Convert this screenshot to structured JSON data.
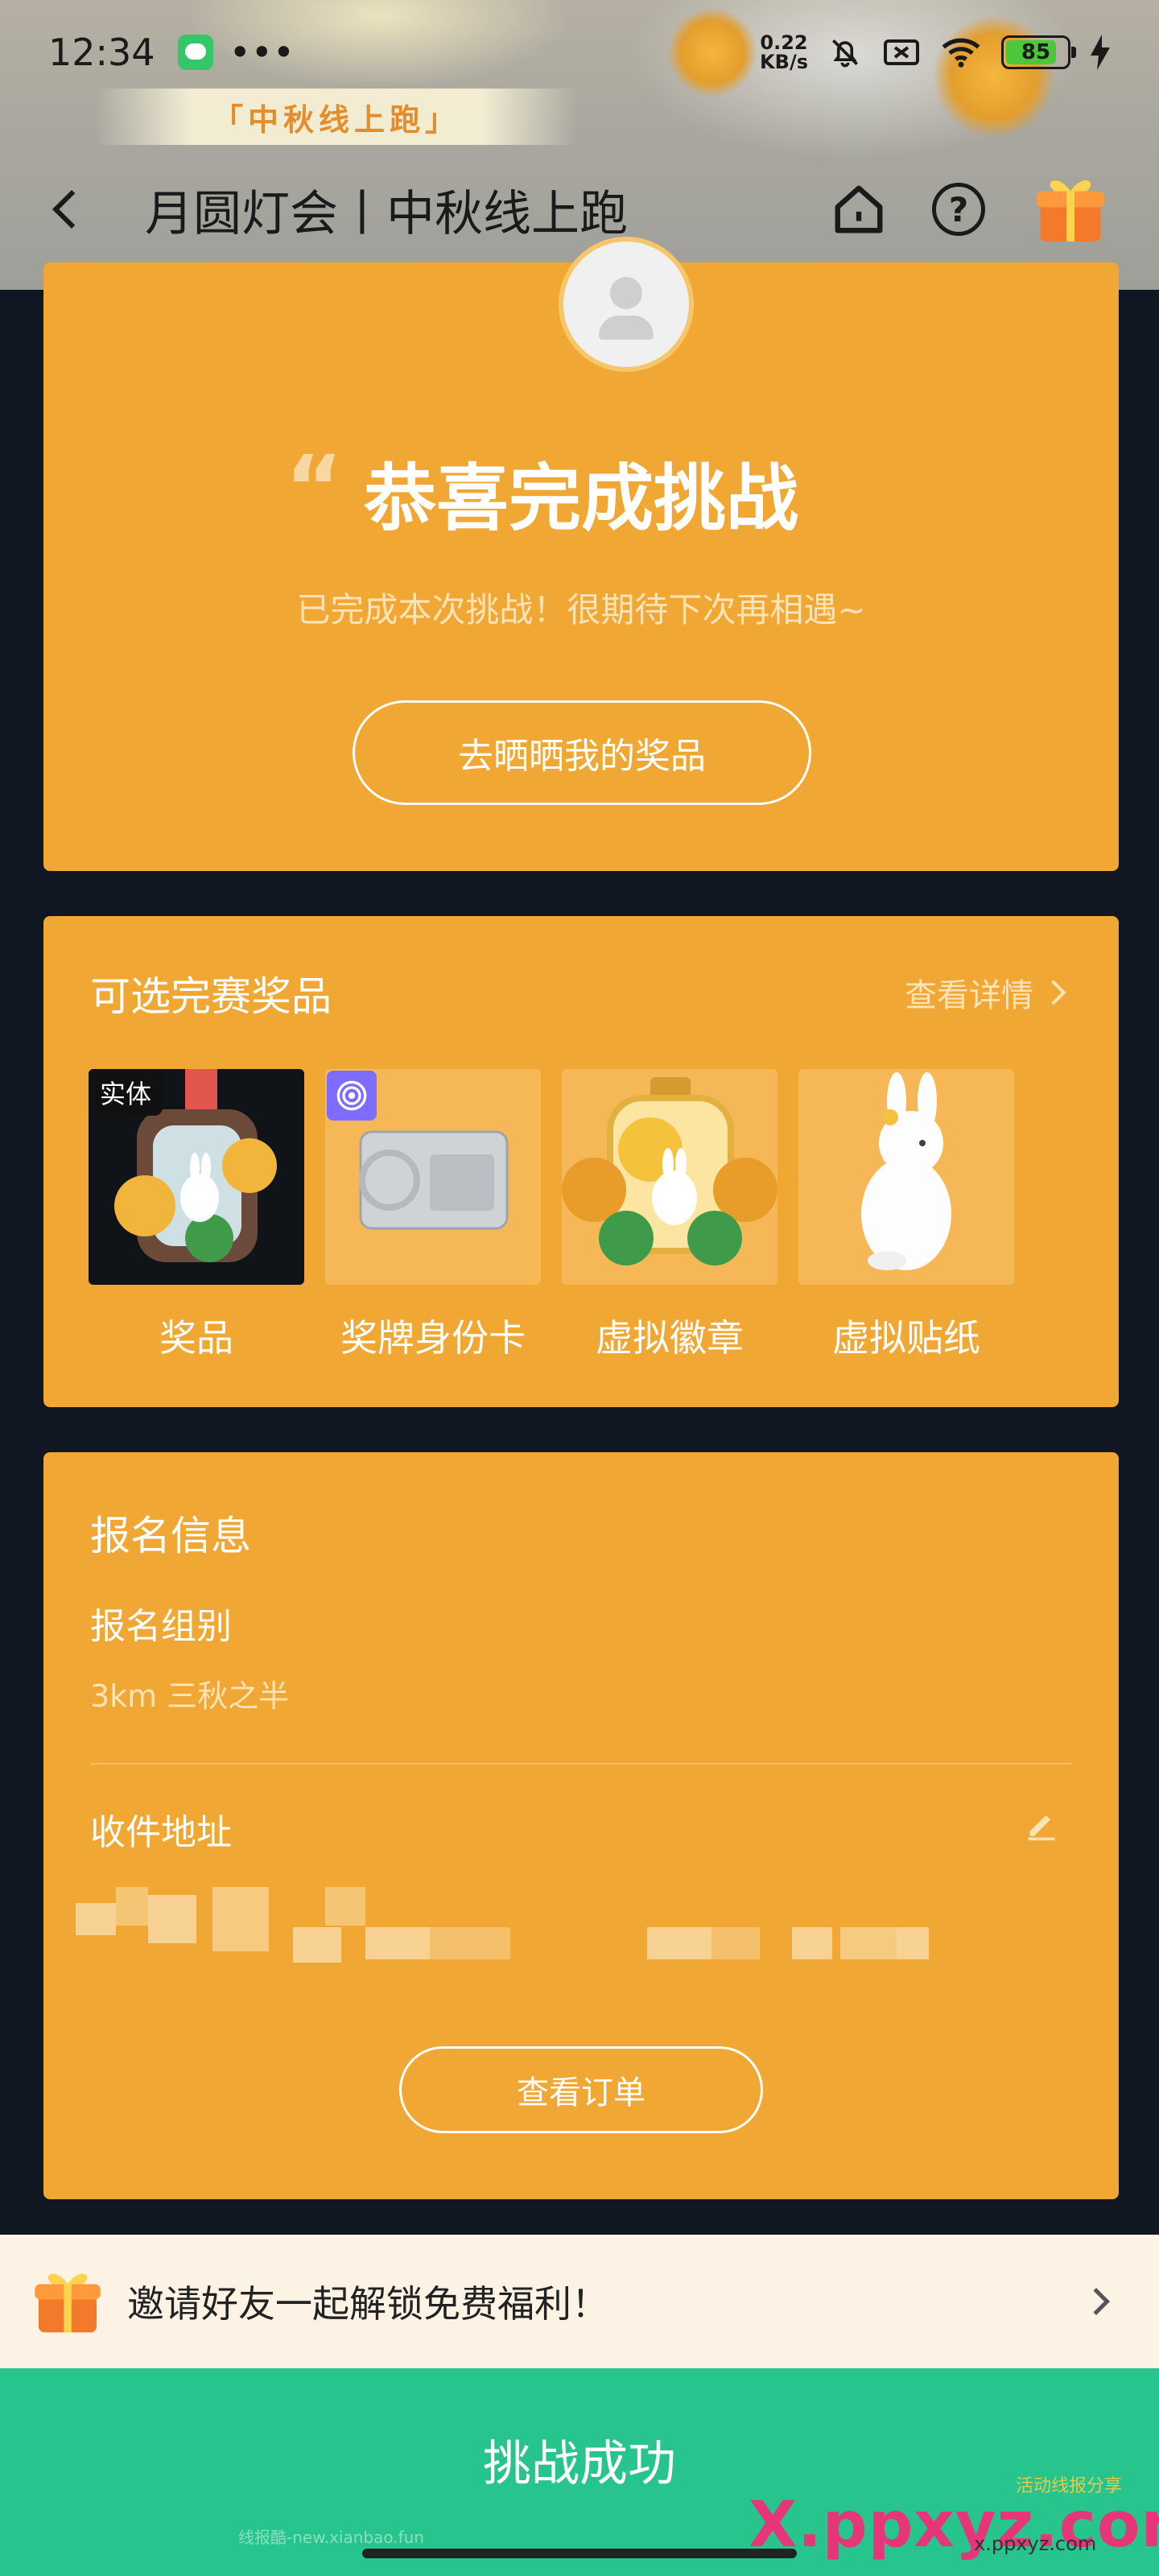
{
  "status_bar": {
    "time": "12:34",
    "more": "•••",
    "net_speed_value": "0.22",
    "net_speed_unit": "KB/s",
    "battery": "85",
    "battery_level": 0.85
  },
  "hero": {
    "subtitle": "「中秋线上跑」"
  },
  "nav": {
    "title": "月圆灯会丨中秋线上跑"
  },
  "congrats": {
    "title": "恭喜完成挑战",
    "subtitle": "已完成本次挑战！很期待下次再相遇~",
    "button": "去晒晒我的奖品"
  },
  "prizes": {
    "heading": "可选完赛奖品",
    "detail_link": "查看详情",
    "items": [
      {
        "label": "奖品",
        "tag": "实体"
      },
      {
        "label": "奖牌身份卡"
      },
      {
        "label": "虚拟徽章"
      },
      {
        "label": "虚拟贴纸"
      }
    ]
  },
  "signup": {
    "heading": "报名信息",
    "group_label": "报名组别",
    "group_value": "3km 三秋之半",
    "address_label": "收件地址",
    "order_button": "查看订单"
  },
  "invite": {
    "text": "邀请好友一起解锁免费福利！"
  },
  "cta": {
    "label": "挑战成功"
  },
  "watermarks": {
    "small": "线报酷-new.xianbao.fun",
    "big": "X.ppxyz.com",
    "big_sub": "x.ppxyz.com",
    "tiny": "活动线报分享"
  },
  "colors": {
    "card": "#f0a733",
    "cta": "#27c58d",
    "background": "#111722",
    "invite_bg": "#fdf3e5"
  }
}
